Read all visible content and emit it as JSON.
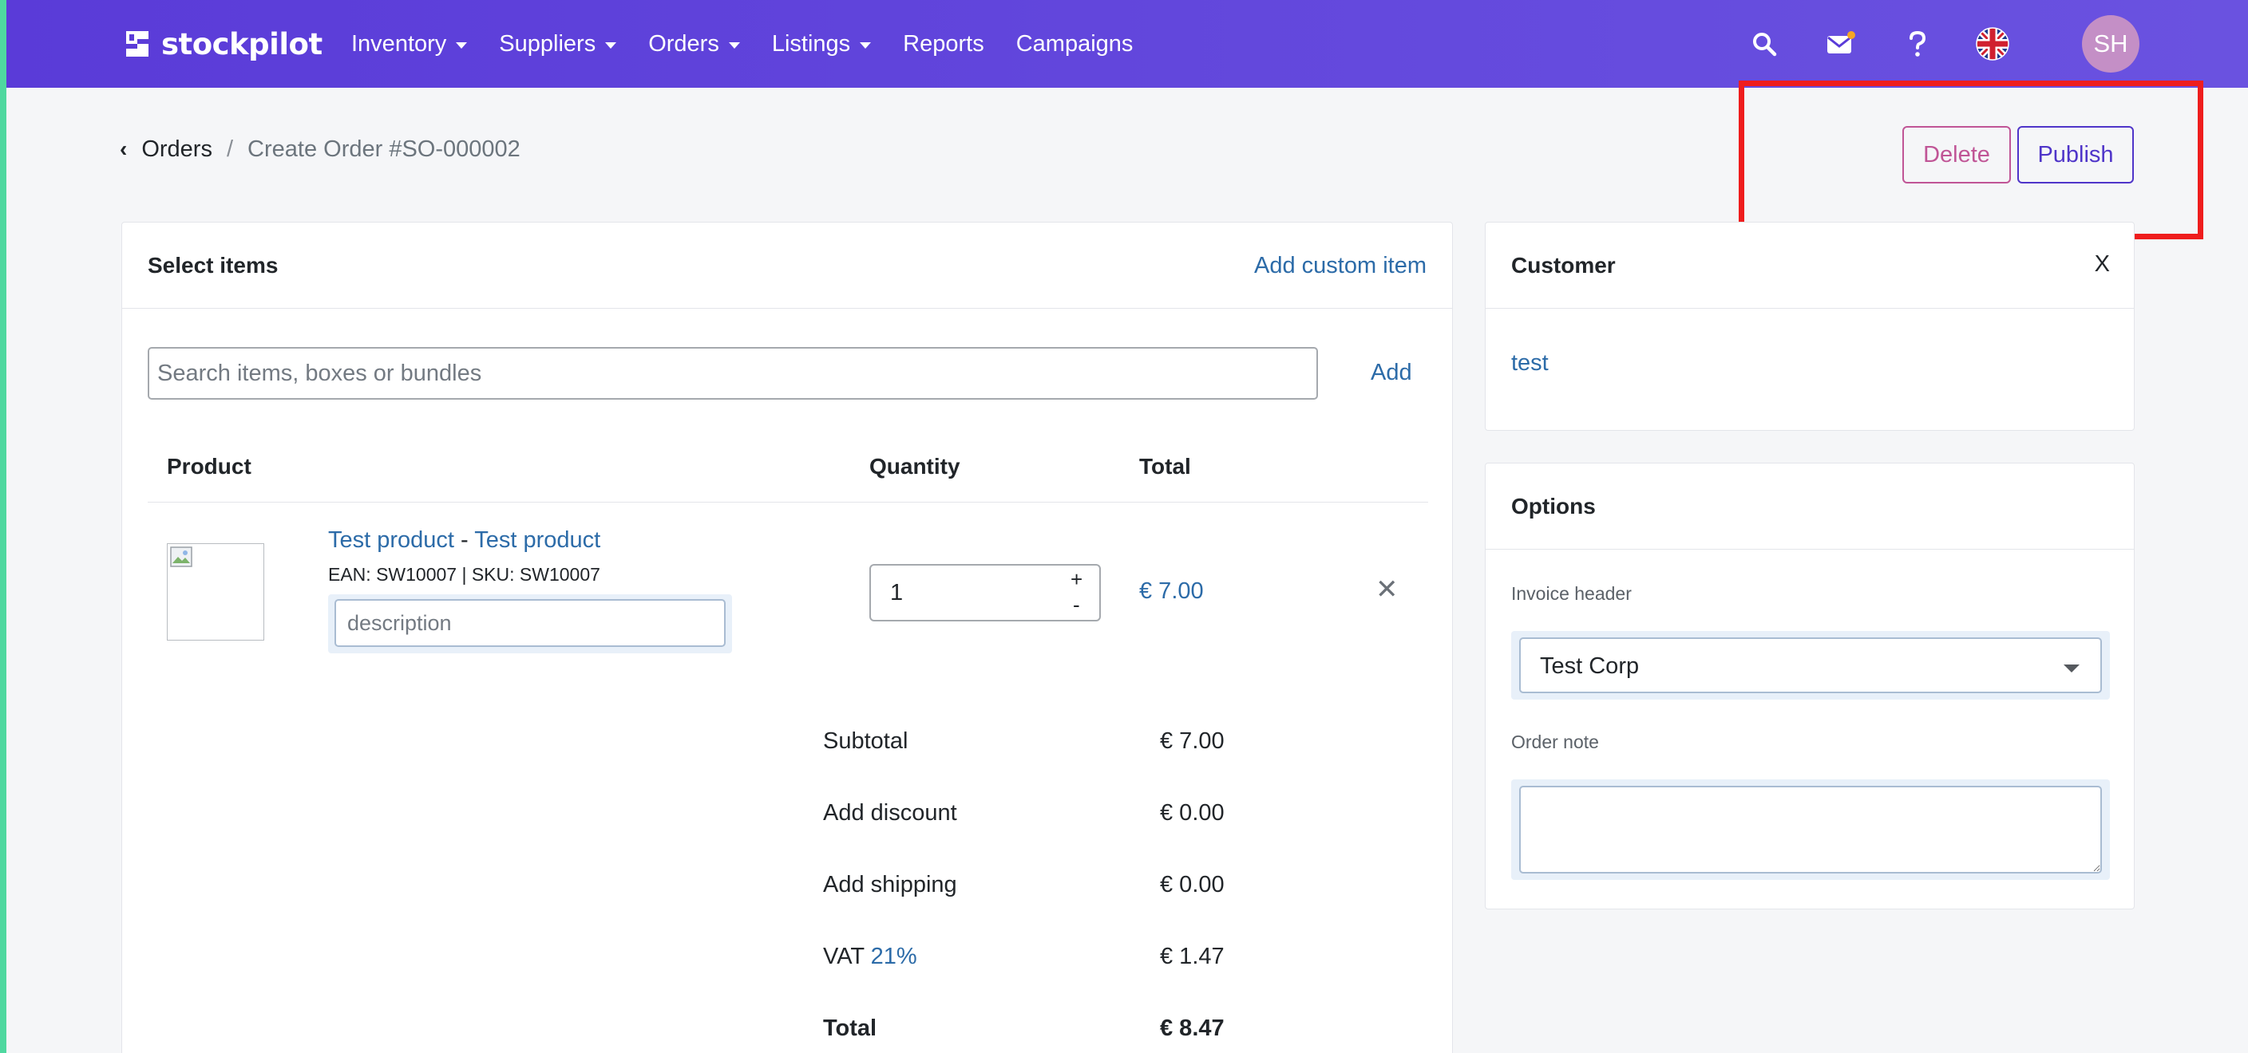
{
  "app": {
    "brand_name": "stockpilot",
    "nav": [
      {
        "label": "Inventory",
        "has_dropdown": true
      },
      {
        "label": "Suppliers",
        "has_dropdown": true
      },
      {
        "label": "Orders",
        "has_dropdown": true
      },
      {
        "label": "Listings",
        "has_dropdown": true
      },
      {
        "label": "Reports",
        "has_dropdown": false
      },
      {
        "label": "Campaigns",
        "has_dropdown": false
      }
    ],
    "nav_icons": [
      "search-icon",
      "mail-icon",
      "help-icon",
      "uk-flag-icon"
    ],
    "notification_dot_color": "#f5a623",
    "user_initials": "SH",
    "accent_color": "#5a3bd8"
  },
  "breadcrumb": {
    "parent": "Orders",
    "separator": "/",
    "current": "Create Order #SO-000002"
  },
  "actions": {
    "delete_label": "Delete",
    "publish_label": "Publish"
  },
  "items_card": {
    "title": "Select items",
    "add_custom_label": "Add custom item",
    "search_placeholder": "Search items, boxes or bundles",
    "add_label": "Add",
    "columns": {
      "product": "Product",
      "quantity": "Quantity",
      "total": "Total"
    },
    "rows": [
      {
        "name_part1": "Test product",
        "name_sep": "-",
        "name_part2": "Test product",
        "codes": "EAN: SW10007 | SKU: SW10007",
        "description_placeholder": "description",
        "quantity": "1",
        "plus": "+",
        "minus": "-",
        "total": "€ 7.00"
      }
    ],
    "summary": {
      "subtotal_label": "Subtotal",
      "subtotal_value": "€ 7.00",
      "discount_label": "Add discount",
      "discount_value": "€ 0.00",
      "shipping_label": "Add shipping",
      "shipping_value": "€ 0.00",
      "vat_label": "VAT",
      "vat_rate": "21%",
      "vat_value": "€ 1.47",
      "total_label": "Total",
      "total_value": "€ 8.47"
    }
  },
  "customer_card": {
    "title": "Customer",
    "close_label": "X",
    "customer_name": "test"
  },
  "options_card": {
    "title": "Options",
    "invoice_header_label": "Invoice header",
    "invoice_header_value": "Test Corp",
    "order_note_label": "Order note"
  }
}
